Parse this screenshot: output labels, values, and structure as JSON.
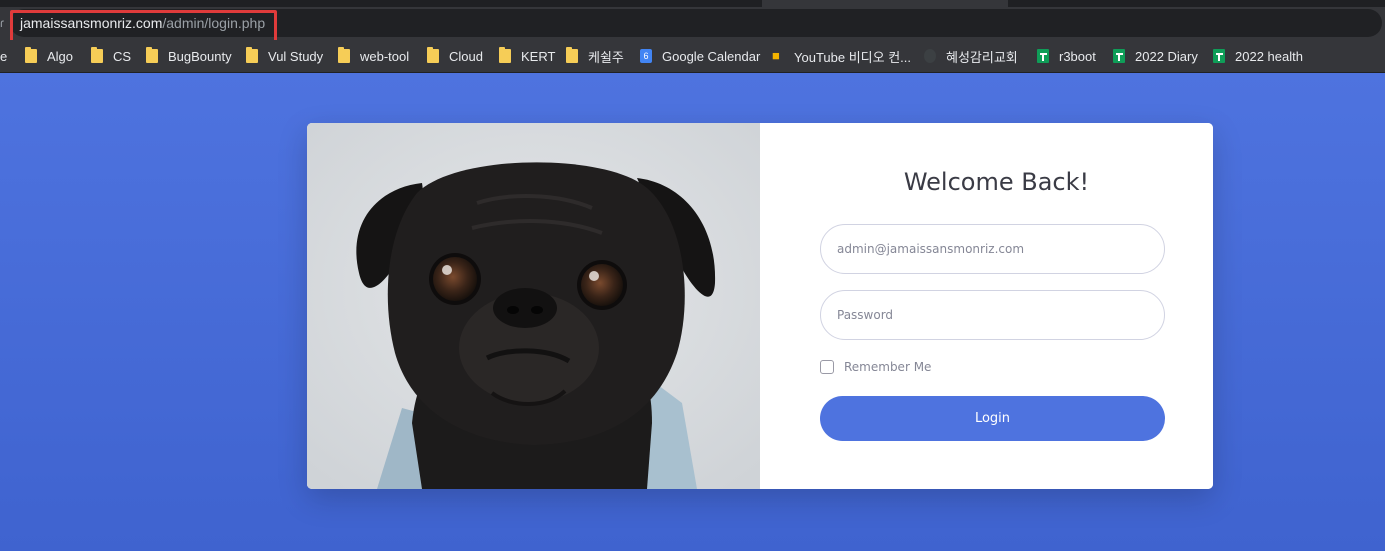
{
  "browser": {
    "url_host": "jamaissansmonriz.com",
    "url_path": "/admin/login.php",
    "left_glyph": "e",
    "bookmarks": [
      {
        "label": "Algo",
        "icon": "folder-icon"
      },
      {
        "label": "CS",
        "icon": "folder-icon"
      },
      {
        "label": "BugBounty",
        "icon": "folder-icon"
      },
      {
        "label": "Vul Study",
        "icon": "folder-icon"
      },
      {
        "label": "web-tool",
        "icon": "folder-icon"
      },
      {
        "label": "Cloud",
        "icon": "folder-icon"
      },
      {
        "label": "KERT",
        "icon": "folder-icon"
      },
      {
        "label": "케쉴주",
        "icon": "folder-icon"
      },
      {
        "label": "Google Calendar",
        "icon": "google-calendar-icon"
      },
      {
        "label": "YouTube 비디오 컨...",
        "icon": "youtube-video-icon"
      },
      {
        "label": "혜성감리교회",
        "icon": "church-icon"
      },
      {
        "label": "r3boot",
        "icon": "google-sheets-icon"
      },
      {
        "label": "2022 Diary",
        "icon": "google-sheets-icon"
      },
      {
        "label": "2022 health",
        "icon": "google-sheets-icon"
      }
    ]
  },
  "login": {
    "title": "Welcome Back!",
    "email_placeholder": "admin@jamaissansmonriz.com",
    "password_placeholder": "Password",
    "remember_label": "Remember Me",
    "login_label": "Login"
  },
  "colors": {
    "primary": "#4e73df",
    "url_highlight": "#e03b3b",
    "chrome_dark": "#35363a",
    "folder": "#f6cd57",
    "sheets": "#0f9d58"
  }
}
